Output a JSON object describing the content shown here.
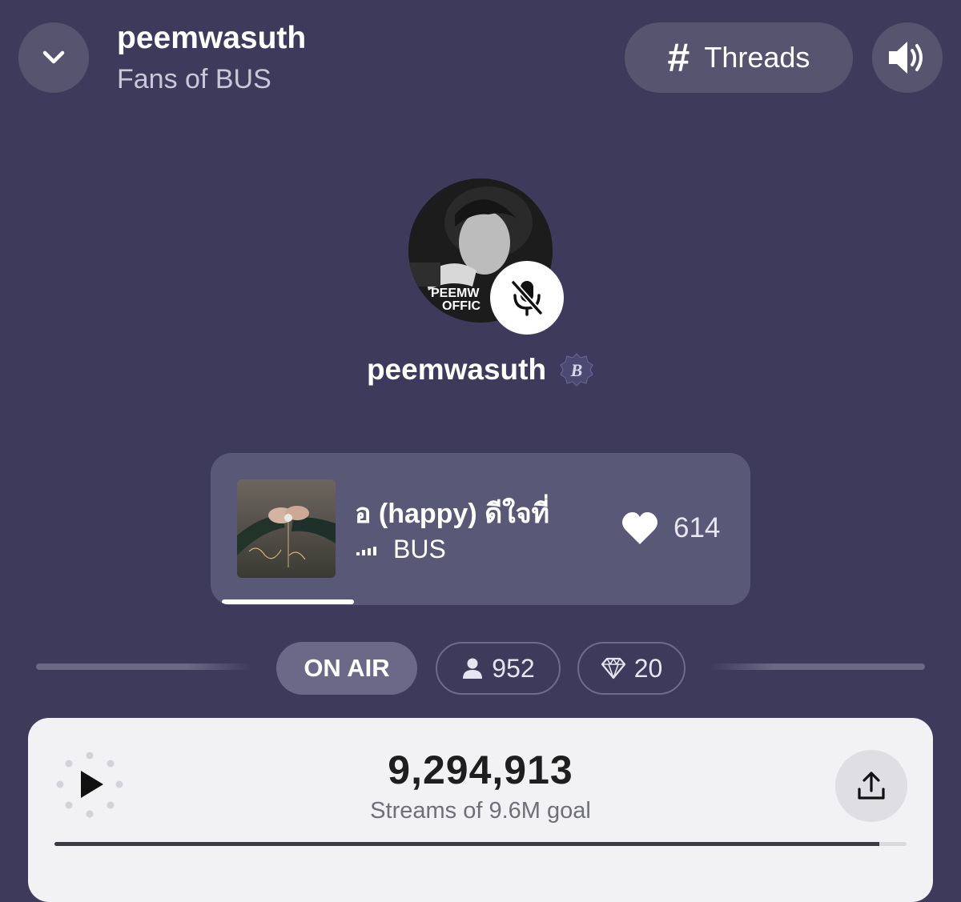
{
  "header": {
    "title": "peemwasuth",
    "subtitle": "Fans of BUS",
    "threads_label": "Threads",
    "icons": {
      "back": "chevron-down-icon",
      "threads": "hash-icon",
      "sound": "speaker-icon"
    }
  },
  "host": {
    "name": "peemwasuth",
    "avatar_text": "PEEMW OFFIC",
    "badge_letter": "B",
    "mic_state": "muted",
    "icons": {
      "mic": "mic-off-icon",
      "badge": "verified-badge-icon"
    }
  },
  "now_playing": {
    "title": "อ (happy)    ดีใจที่",
    "artist": "BUS",
    "likes": "614",
    "progress_fraction": 0.25,
    "icons": {
      "like": "heart-icon",
      "equalizer": "equalizer-icon"
    }
  },
  "status": {
    "on_air": "ON AIR",
    "listeners": "952",
    "gems": "20",
    "icons": {
      "listeners": "person-icon",
      "gems": "diamond-icon"
    }
  },
  "streams": {
    "count": "9,294,913",
    "goal_label": "Streams of 9.6M goal",
    "progress_fraction": 0.968,
    "icons": {
      "play": "play-icon",
      "share": "share-icon"
    }
  },
  "colors": {
    "background": "#3d3a5c",
    "card": "#5a5877",
    "panel": "#f2f2f5",
    "accent_white": "#ffffff"
  }
}
